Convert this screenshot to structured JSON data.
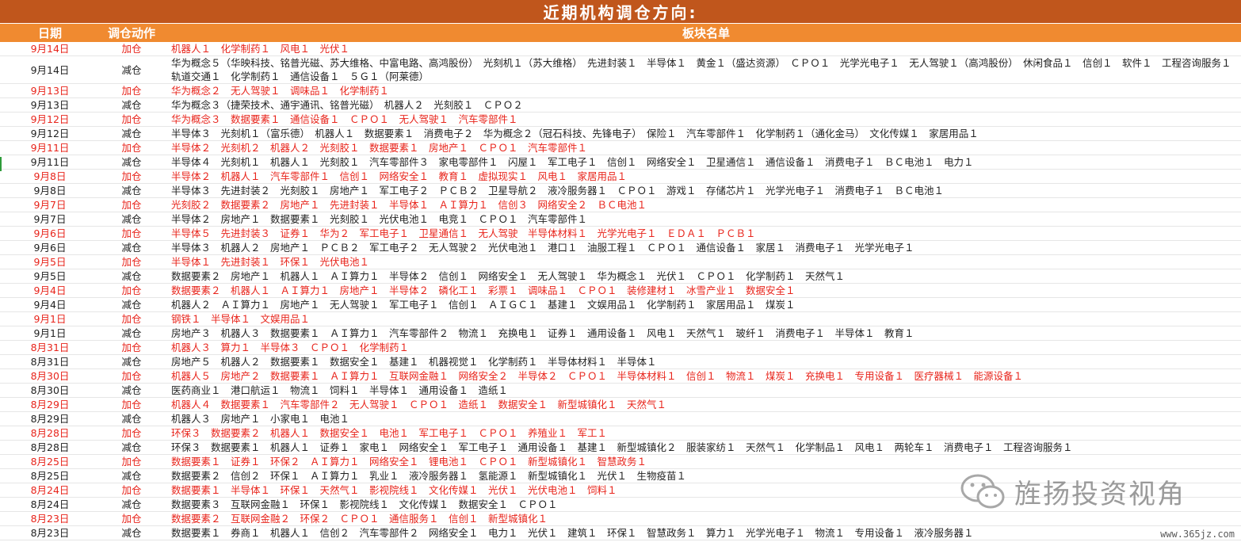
{
  "title": "近期机构调仓方向:",
  "headers": {
    "date": "日期",
    "action": "调仓动作",
    "sectors": "板块名单"
  },
  "rows": [
    {
      "date": "9月14日",
      "action": "加仓",
      "type": "add",
      "sectors": "机器人１　化学制药１　风电１　光伏１"
    },
    {
      "date": "9月14日",
      "action": "减仓",
      "type": "sub",
      "tall": true,
      "sectors": "华为概念５（华映科技、铭普光磁、苏大维格、中富电路、高鸿股份）　光刻机１（苏大维格）　先进封装１　半导体１　黄金１（盛达资源）　ＣＰＯ１　光学光电子１　无人驾驶１（高鸿股份）　休闲食品１　信创１　软件１　工程咨询服务１　轨道交通１　化学制药１　通信设备１　５Ｇ１（阿莱德）"
    },
    {
      "date": "9月13日",
      "action": "加仓",
      "type": "add",
      "sectors": "华为概念２　无人驾驶１　调味品１　化学制药１"
    },
    {
      "date": "9月13日",
      "action": "减仓",
      "type": "sub",
      "sectors": "华为概念３（捷荣技术、通宇通讯、铭普光磁）　机器人２　光刻胶１　ＣＰＯ２"
    },
    {
      "date": "9月12日",
      "action": "加仓",
      "type": "add",
      "sectors": "华为概念３　数据要素１　通信设备１　ＣＰＯ１　无人驾驶１　汽车零部件１"
    },
    {
      "date": "9月12日",
      "action": "减仓",
      "type": "sub",
      "sectors": "半导体３　光刻机１（富乐德）　机器人１　数据要素１　消费电子２　华为概念２（冠石科技、先锋电子）　保险１　汽车零部件１　化学制药１（通化金马）　文化传媒１　家居用品１"
    },
    {
      "date": "9月11日",
      "action": "加仓",
      "type": "add",
      "sectors": "半导体２　光刻机２　机器人２　光刻胶１　数据要素１　房地产１　ＣＰＯ１　汽车零部件１"
    },
    {
      "date": "9月11日",
      "action": "减仓",
      "type": "sub",
      "sectors": "半导体４　光刻机１　机器人１　光刻胶１　汽车零部件３　家电零部件１　闪屋１　军工电子１　信创１　网络安全１　卫星通信１　通信设备１　消费电子１　ＢＣ电池１　电力１"
    },
    {
      "date": "9月8日",
      "action": "加仓",
      "type": "add",
      "sectors": "半导体２　机器人１　汽车零部件１　信创１　网络安全１　教育１　虚拟现实１　风电１　家居用品１"
    },
    {
      "date": "9月8日",
      "action": "减仓",
      "type": "sub",
      "sectors": "半导体３　先进封装２　光刻胶１　房地产１　军工电子２　ＰＣＢ２　卫星导航２　液冷服务器１　ＣＰＯ１　游戏１　存储芯片１　光学光电子１　消费电子１　ＢＣ电池１"
    },
    {
      "date": "9月7日",
      "action": "加仓",
      "type": "add",
      "sectors": "光刻胶２　数据要素２　房地产１　先进封装１　半导体１　ＡＩ算力１　信创３　网络安全２　ＢＣ电池１"
    },
    {
      "date": "9月7日",
      "action": "减仓",
      "type": "sub",
      "sectors": "半导体２　房地产１　数据要素１　光刻胶１　光伏电池１　电竞１　ＣＰＯ１　汽车零部件１"
    },
    {
      "date": "9月6日",
      "action": "加仓",
      "type": "add",
      "sectors": "半导体５　先进封装３　证券１　华为２　军工电子１　卫星通信１　无人驾驶　半导体材料１　光学光电子１　ＥＤＡ１　ＰＣＢ１"
    },
    {
      "date": "9月6日",
      "action": "减仓",
      "type": "sub",
      "sectors": "半导体３　机器人２　房地产１　ＰＣＢ２　军工电子２　无人驾驶２　光伏电池１　港口１　油服工程１　ＣＰＯ１　通信设备１　家居１　消费电子１　光学光电子１"
    },
    {
      "date": "9月5日",
      "action": "加仓",
      "type": "add",
      "sectors": "半导体１　先进封装１　环保１　光伏电池１"
    },
    {
      "date": "9月5日",
      "action": "减仓",
      "type": "sub",
      "sectors": "数据要素２　房地产１　机器人１　ＡＩ算力１　半导体２　信创１　网络安全１　无人驾驶１　华为概念１　光伏１　ＣＰＯ１　化学制药１　天然气１"
    },
    {
      "date": "9月4日",
      "action": "加仓",
      "type": "add",
      "sectors": "数据要素２　机器人１　ＡＩ算力１　房地产１　半导体２　磷化工１　彩票１　调味品１　ＣＰＯ１　装修建材１　冰雪产业１　数据安全１"
    },
    {
      "date": "9月4日",
      "action": "减仓",
      "type": "sub",
      "sectors": "机器人２　ＡＩ算力１　房地产１　无人驾驶１　军工电子１　信创１　ＡＩＧＣ１　基建１　文娱用品１　化学制药１　家居用品１　煤炭１"
    },
    {
      "date": "9月1日",
      "action": "加仓",
      "type": "add",
      "sectors": "钢铁１　半导体１　文娱用品１"
    },
    {
      "date": "9月1日",
      "action": "减仓",
      "type": "sub",
      "sectors": "房地产３　机器人３　数据要素１　ＡＩ算力１　汽车零部件２　物流１　充换电１　证券１　通用设备１　风电１　天然气１　玻纤１　消费电子１　半导体１　教育１"
    },
    {
      "date": "8月31日",
      "action": "加仓",
      "type": "add",
      "sectors": "机器人３　算力１　半导体３　ＣＰＯ１　化学制药１"
    },
    {
      "date": "8月31日",
      "action": "减仓",
      "type": "sub",
      "sectors": "房地产５　机器人２　数据要素１　数据安全１　基建１　机器视觉１　化学制药１　半导体材料１　半导体１"
    },
    {
      "date": "8月30日",
      "action": "加仓",
      "type": "add",
      "sectors": "机器人５　房地产２　数据要素１　ＡＩ算力１　互联网金融１　网络安全２　半导体２　ＣＰＯ１　半导体材料１　信创１　物流１　煤炭１　充换电１　专用设备１　医疗器械１　能源设备１"
    },
    {
      "date": "8月30日",
      "action": "减仓",
      "type": "sub",
      "sectors": "医药商业１　港口航运１　物流１　饲料１　半导体１　通用设备１　造纸１"
    },
    {
      "date": "8月29日",
      "action": "加仓",
      "type": "add",
      "sectors": "机器人４　数据要素１　汽车零部件２　无人驾驶１　ＣＰＯ１　造纸１　数据安全１　新型城镇化１　天然气１"
    },
    {
      "date": "8月29日",
      "action": "减仓",
      "type": "sub",
      "sectors": "机器人３　房地产１　小家电１　电池１"
    },
    {
      "date": "8月28日",
      "action": "加仓",
      "type": "add",
      "sectors": "环保３　数据要素２　机器人１　数据安全１　电池１　军工电子１　ＣＰＯ１　养殖业１　军工１"
    },
    {
      "date": "8月28日",
      "action": "减仓",
      "type": "sub",
      "sectors": "环保３　数据要素１　机器人１　证券１　家电１　网络安全１　军工电子１　通用设备１　基建１　新型城镇化２　服装家纺１　天然气１　化学制品１　风电１　两轮车１　消费电子１　工程咨询服务１"
    },
    {
      "date": "8月25日",
      "action": "加仓",
      "type": "add",
      "sectors": "数据要素１　证券１　环保２　ＡＩ算力１　网络安全１　锂电池１　ＣＰＯ１　新型城镇化１　智慧政务１"
    },
    {
      "date": "8月25日",
      "action": "减仓",
      "type": "sub",
      "sectors": "数据要素２　信创２　环保１　ＡＩ算力１　乳业１　液冷服务器１　氢能源１　新型城镇化１　光伏１　生物疫苗１"
    },
    {
      "date": "8月24日",
      "action": "加仓",
      "type": "add",
      "sectors": "数据要素１　半导体１　环保１　天然气１　影视院线１　文化传媒１　光伏１　光伏电池１　饲料１"
    },
    {
      "date": "8月24日",
      "action": "减仓",
      "type": "sub",
      "sectors": "数据要素３　互联网金融１　环保１　影视院线１　文化传媒１　数据安全１　ＣＰＯ１"
    },
    {
      "date": "8月23日",
      "action": "加仓",
      "type": "add",
      "sectors": "数据要素２　互联网金融２　环保２　ＣＰＯ１　通信服务１　信创１　新型城镇化１"
    },
    {
      "date": "8月23日",
      "action": "减仓",
      "type": "sub",
      "sectors": "数据要素１　券商１　机器人１　信创２　汽车零部件２　网络安全１　电力１　光伏１　建筑１　环保１　智慧政务１　算力１　光学光电子１　物流１　专用设备１　液冷服务器１"
    }
  ],
  "watermark": {
    "text": "旌扬投资视角",
    "icon": "wechat-icon"
  },
  "site": "www.365jz.com"
}
